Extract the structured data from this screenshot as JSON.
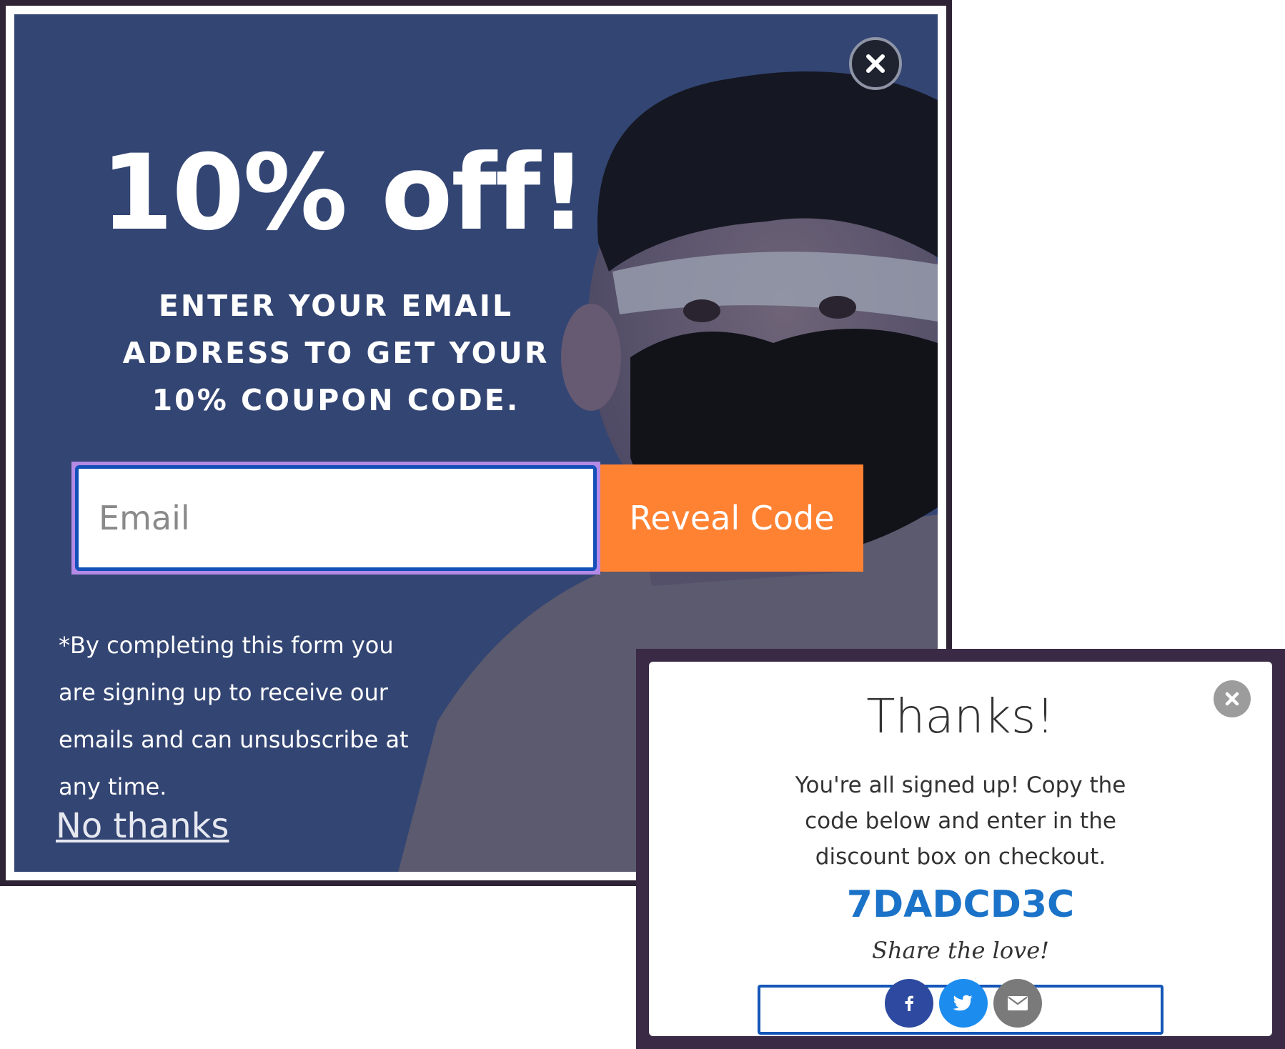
{
  "offer_popup": {
    "headline": "10% off!",
    "subhead_lines": [
      "ENTER YOUR EMAIL",
      "ADDRESS TO GET YOUR",
      "10% COUPON CODE."
    ],
    "email_placeholder": "Email",
    "email_value": "",
    "reveal_button": "Reveal Code",
    "disclaimer_lines": [
      "*By completing this form you",
      "are signing up to receive our",
      "emails and can unsubscribe at",
      "any time."
    ],
    "no_thanks": "No thanks",
    "close_icon": "close-icon"
  },
  "thanks_popup": {
    "title": "Thanks!",
    "body_lines": [
      "You're all signed up! Copy the",
      "code below and enter in the",
      "discount box on checkout."
    ],
    "coupon_code": "7DADCD3C",
    "share_label": "Share the love!",
    "share_buttons": [
      "facebook-icon",
      "twitter-icon",
      "email-icon"
    ],
    "close_icon": "close-icon"
  },
  "colors": {
    "panel_blue": "#334573",
    "accent_orange": "#ff8132",
    "coupon_blue": "#1a73c8",
    "facebook": "#2d4aa0",
    "twitter": "#1d8cef",
    "email_gray": "#7a7a7a"
  }
}
